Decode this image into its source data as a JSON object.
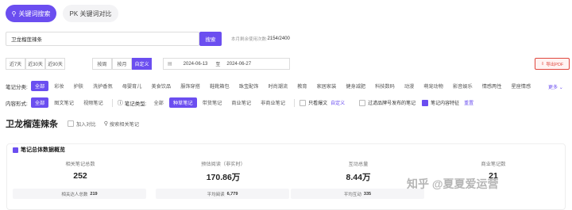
{
  "tabs": [
    {
      "label": "关键词搜索"
    },
    {
      "label": "PK 关键词对比"
    }
  ],
  "search": {
    "value": "卫龙榴莲辣条",
    "button": "搜索",
    "quota_label": "本月剩余使用次数:",
    "quota_value": "2154/2400"
  },
  "time": {
    "ranges": [
      "近7天",
      "近30天",
      "近90天"
    ],
    "periods": [
      "按周",
      "按月",
      "自定义"
    ],
    "start": "2024-06-13",
    "sep": "至",
    "end": "2024-06-27",
    "export": "导出PDF"
  },
  "categories": {
    "label": "笔记分类:",
    "items": [
      "全部",
      "彩妆",
      "护肤",
      "洗护香氛",
      "母婴育儿",
      "美食饮品",
      "服饰穿搭",
      "鞋靴箱包",
      "珠宝配饰",
      "时尚潮流",
      "教育",
      "家居家装",
      "健身减肥",
      "科技数码",
      "动漫",
      "萌宠动物",
      "影音娱乐",
      "情感两性",
      "星座情感"
    ],
    "more": "更多"
  },
  "content_form": {
    "label": "内容形式:",
    "items": [
      "全部",
      "图文笔记",
      "视频笔记"
    ]
  },
  "note_type": {
    "label": "笔记类型:",
    "items": [
      "全部",
      "种草笔记",
      "带货笔记",
      "商业笔记",
      "非商业笔记"
    ]
  },
  "filters": {
    "only_original": "只看爆文",
    "custom": "自定义",
    "filter_brand": "过滤品牌号发布的笔记",
    "feature": "笔记内容特征",
    "reset": "重置"
  },
  "keyword": {
    "title": "卫龙榴莲辣条",
    "add_compare": "加入对比",
    "search_related": "搜索相关笔记"
  },
  "overview": {
    "title": "笔记总体数据概览",
    "metrics": [
      {
        "label": "相关笔记总数",
        "value": "252",
        "sub_label": "相关达人总数",
        "sub_value": "219"
      },
      {
        "label": "预估阅读（非实时）",
        "value": "170.86万",
        "sub_label": "平均阅读",
        "sub_value": "6,779"
      },
      {
        "label": "互动总量",
        "value": "8.44万",
        "sub_label": "平均互动",
        "sub_value": "335"
      },
      {
        "label": "商业笔记数",
        "value": "21",
        "sub_label": "",
        "sub_value": ""
      }
    ]
  },
  "watermark": "知乎 @夏夏爱运营",
  "colors": {
    "accent": "#6b4ef0",
    "export": "#e0473e"
  }
}
